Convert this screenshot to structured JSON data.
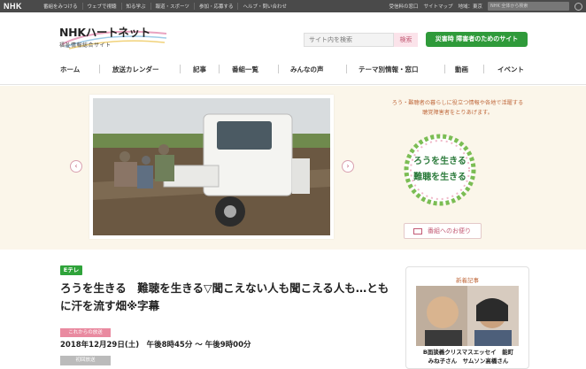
{
  "topbar": {
    "logo": "NHK",
    "links": [
      "番組をみつける",
      "ウェブで視聴",
      "知る学ぶ",
      "報道・スポーツ",
      "参加・応募する",
      "ヘルプ・問い合わせ"
    ],
    "right_links": [
      "受信料の窓口",
      "サイトマップ",
      "地域：東京"
    ],
    "search_placeholder": "NHK 全体から検索"
  },
  "header": {
    "site_title": "NHKハートネット",
    "site_subtitle": "福祉情報総合サイト",
    "search_placeholder": "サイト内を検索",
    "search_button": "検索",
    "disaster_button": "災害時 障害者のためのサイト"
  },
  "nav": {
    "items": [
      "ホーム",
      "放送カレンダー",
      "記事",
      "番組一覧",
      "みんなの声",
      "テーマ別情報・窓口",
      "動画",
      "イベント"
    ]
  },
  "hero": {
    "description_lines": [
      "ろう・難聴者の暮らしに役立つ情報や各地で活躍する",
      "聴覚障害者をとりあげます。"
    ],
    "badge_text": "ろうを生きる 難聴を生きる",
    "letter_button": "番組へのお便り",
    "colors": {
      "accent": "#c25a74",
      "background": "#fbf6ea"
    }
  },
  "program": {
    "channel": "Eテレ",
    "title": "ろうを生きる　難聴を生きる▽聞こえない人も聞こえる人も…ともに汗を流す畑※字幕",
    "upcoming_label": "これからの放送",
    "datetime": "2018年12月29日(土)　午後8時45分 ～ 午後9時00分",
    "first_broadcast_label": "初回放送"
  },
  "news": {
    "heading": "新着記事",
    "caption_lines": [
      "B面談義クリスマスエッセイ　能町",
      "みね子さん　サムソン高橋さん"
    ]
  }
}
